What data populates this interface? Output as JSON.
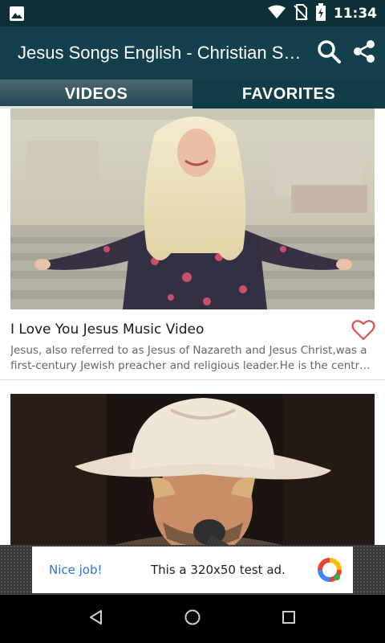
{
  "status_bar": {
    "time": "11:34",
    "icons": [
      "image-icon",
      "wifi-icon",
      "no-sim-icon",
      "battery-charging-icon"
    ]
  },
  "app_bar": {
    "title": "Jesus Songs English - Christian Songs",
    "actions": [
      "search-icon",
      "share-icon"
    ]
  },
  "tabs": [
    {
      "label": "VIDEOS",
      "active": true
    },
    {
      "label": "FAVORITES",
      "active": false
    }
  ],
  "videos": [
    {
      "title": "I Love You Jesus Music Video",
      "description_line1": "Jesus, also referred to as Jesus of Nazareth and Jesus Christ,was a",
      "description_line2": "first-century Jewish preacher and religious leader.He is the central figure of Christianity.",
      "favorite": false
    },
    {
      "title": "",
      "description_line1": "",
      "description_line2": "",
      "favorite": false
    }
  ],
  "ad": {
    "left_text": "Nice job!",
    "main_text": "This a 320x50 test ad."
  },
  "colors": {
    "status_bar": "#0d2f38",
    "app_bar": "#143f4c",
    "tab_bar": "#113c48",
    "ad_link": "#2f74d8",
    "favorite_heart": "#d9534f"
  }
}
